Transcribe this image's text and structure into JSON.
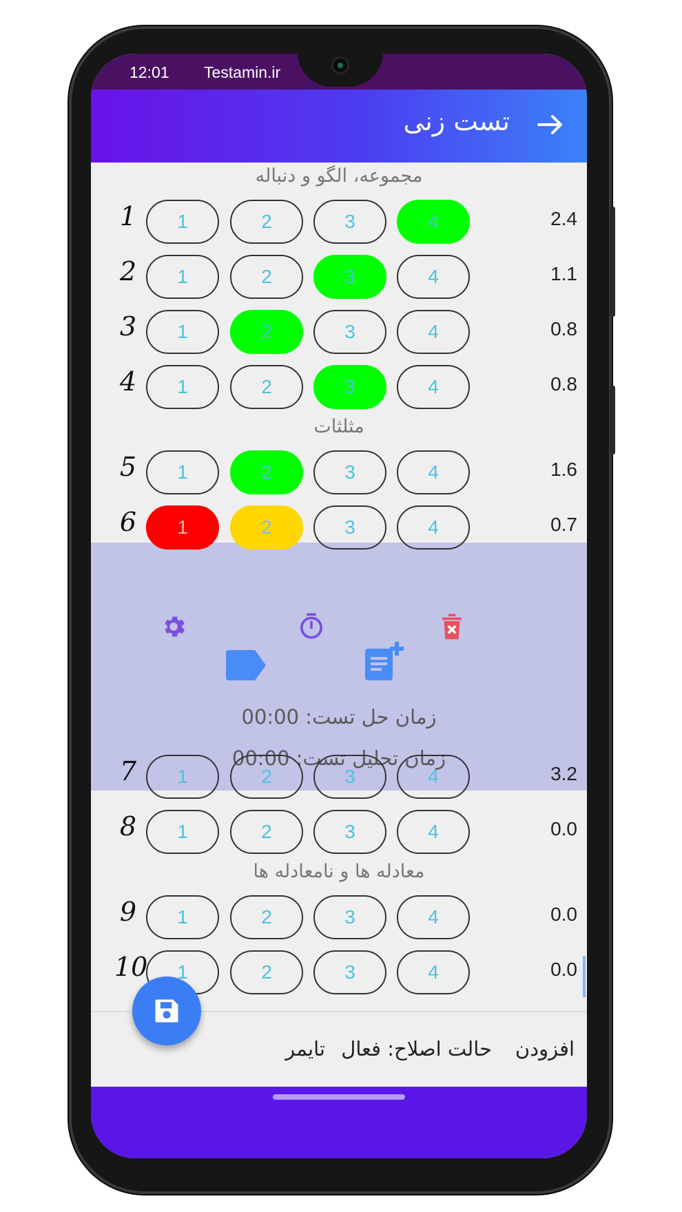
{
  "status": {
    "time": "12:01",
    "site": "Testamin.ir"
  },
  "appbar": {
    "title": "تست زنی",
    "back_icon": "arrow-right-icon"
  },
  "sections": [
    {
      "title": "مجموعه، الگو و دنباله"
    },
    {
      "title": "مثلثات"
    },
    {
      "title": "معادله ها و نامعادله ها"
    }
  ],
  "questions": [
    {
      "number": "1",
      "options": [
        "1",
        "2",
        "3",
        "4"
      ],
      "score": "2.4",
      "selected": "4",
      "state": "correct"
    },
    {
      "number": "2",
      "options": [
        "1",
        "2",
        "3",
        "4"
      ],
      "score": "1.1",
      "selected": "3",
      "state": "correct"
    },
    {
      "number": "3",
      "options": [
        "1",
        "2",
        "3",
        "4"
      ],
      "score": "0.8",
      "selected": "2",
      "state": "correct"
    },
    {
      "number": "4",
      "options": [
        "1",
        "2",
        "3",
        "4"
      ],
      "score": "0.8",
      "selected": "3",
      "state": "correct"
    },
    {
      "number": "5",
      "options": [
        "1",
        "2",
        "3",
        "4"
      ],
      "score": "1.6",
      "selected": "2",
      "state": "correct"
    },
    {
      "number": "6",
      "options": [
        "1",
        "2",
        "3",
        "4"
      ],
      "score": "0.7",
      "wrong": "1",
      "answer": "2",
      "state": "wrong"
    },
    {
      "number": "7",
      "options": [
        "1",
        "2",
        "3",
        "4"
      ],
      "score": "3.2"
    },
    {
      "number": "8",
      "options": [
        "1",
        "2",
        "3",
        "4"
      ],
      "score": "0.0"
    },
    {
      "number": "9",
      "options": [
        "1",
        "2",
        "3",
        "4"
      ],
      "score": "0.0"
    },
    {
      "number": "10",
      "options": [
        "1",
        "2",
        "3",
        "4"
      ],
      "score": "0.0"
    }
  ],
  "expanded": {
    "icons": [
      "gear-icon",
      "timer-icon",
      "trash-icon",
      "tag-icon",
      "note-add-icon"
    ],
    "solve_time": "زمان حل تست: 00:00",
    "analysis_time": "زمان تحلیل تست: 00:00"
  },
  "bottombar": {
    "add": "افزودن",
    "correction_mode": "حالت اصلاح: فعال",
    "timer": "تایمر"
  },
  "fab": {
    "icon": "save-icon"
  },
  "colors": {
    "correct": "#00ff00",
    "wrong": "#ff0000",
    "answer": "#ffd700",
    "expanded_bg": "#c1c3e7",
    "accent": "#3b7df5"
  }
}
